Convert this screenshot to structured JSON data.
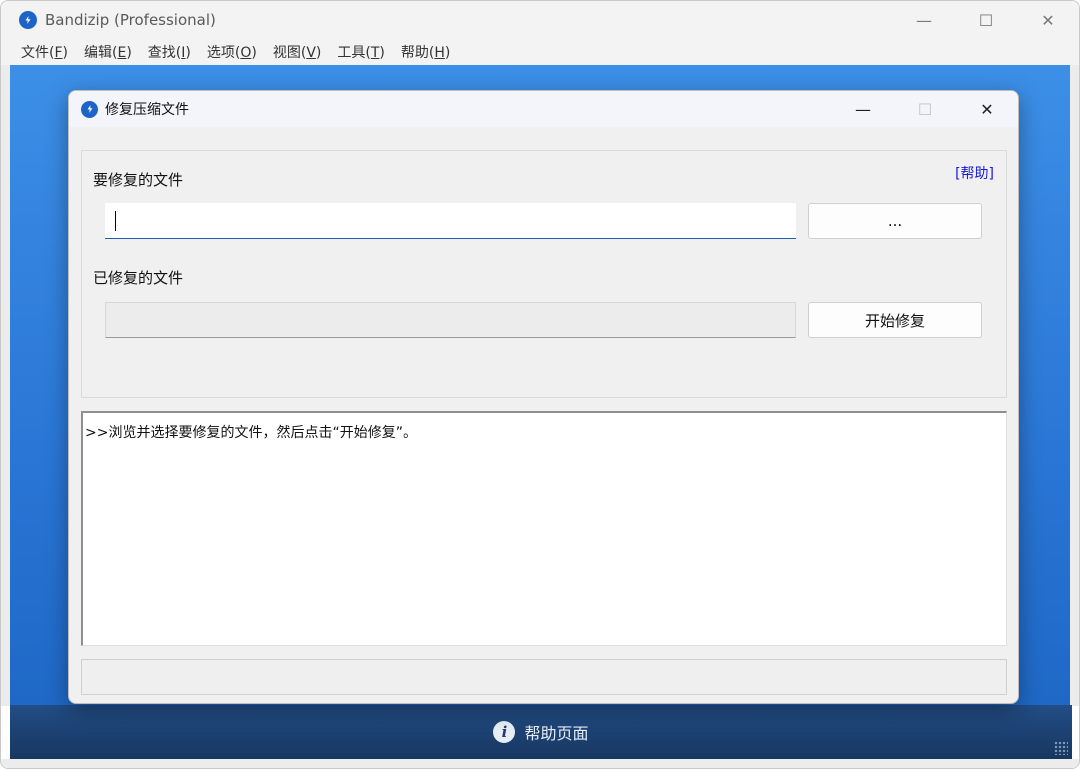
{
  "main_window": {
    "title": "Bandizip (Professional)",
    "controls": {
      "minimize": "—",
      "maximize": "☐",
      "close": "✕"
    }
  },
  "menu": [
    {
      "label": "文件(",
      "key": "F",
      "end": ")"
    },
    {
      "label": "编辑(",
      "key": "E",
      "end": ")"
    },
    {
      "label": "查找(",
      "key": "I",
      "end": ")"
    },
    {
      "label": "选项(",
      "key": "O",
      "end": ")"
    },
    {
      "label": "视图(",
      "key": "V",
      "end": ")"
    },
    {
      "label": "工具(",
      "key": "T",
      "end": ")"
    },
    {
      "label": "帮助(",
      "key": "H",
      "end": ")"
    }
  ],
  "statusbar": {
    "label": "帮助页面",
    "icon": "info-icon"
  },
  "dialog": {
    "title": "修复压缩文件",
    "controls": {
      "minimize": "—",
      "maximize": "☐",
      "close": "✕"
    },
    "help_link": "[帮助]",
    "source_label": "要修复的文件",
    "source_value": "",
    "browse_label": "...",
    "dest_label": "已修复的文件",
    "dest_value": "",
    "start_label": "开始修复",
    "log_text": ">>浏览并选择要修复的文件，然后点击“开始修复”。"
  },
  "colors": {
    "accent": "#1e64c8",
    "help_link": "#1a1adb",
    "status_bg": "#17375f"
  }
}
